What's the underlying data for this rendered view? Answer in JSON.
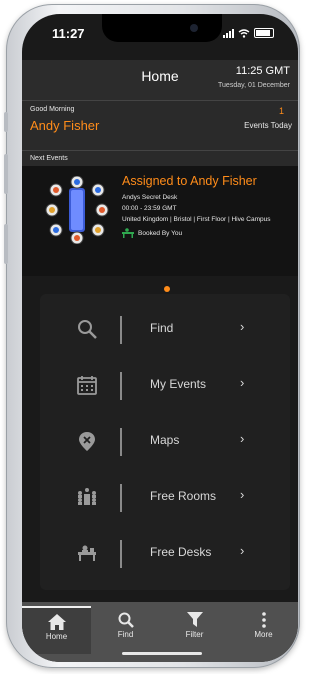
{
  "status_bar": {
    "time": "11:27"
  },
  "header": {
    "title": "Home",
    "time": "11:25 GMT",
    "date": "Tuesday, 01 December"
  },
  "greeting": {
    "text": "Good Morning",
    "user_name": "Andy Fisher",
    "events_count": "1",
    "events_label": "Events Today"
  },
  "next_events_label": "Next Events",
  "event": {
    "title": "Assigned to Andy Fisher",
    "resource": "Andys Secret Desk",
    "time_range": "00:00 - 23:59 GMT",
    "location": "United Kingdom | Bristol | First Floor | Hive Campus",
    "status": "Booked By You"
  },
  "menu": {
    "items": [
      {
        "label": "Find",
        "icon": "search-icon"
      },
      {
        "label": "My Events",
        "icon": "calendar-icon"
      },
      {
        "label": "Maps",
        "icon": "map-pin-icon"
      },
      {
        "label": "Free Rooms",
        "icon": "meeting-room-icon"
      },
      {
        "label": "Free Desks",
        "icon": "desk-icon"
      }
    ],
    "chevron": "›"
  },
  "tabs": [
    {
      "label": "Home",
      "icon": "home-icon",
      "active": true
    },
    {
      "label": "Find",
      "icon": "search-icon",
      "active": false
    },
    {
      "label": "Filter",
      "icon": "filter-icon",
      "active": false
    },
    {
      "label": "More",
      "icon": "more-vertical-icon",
      "active": false
    }
  ],
  "colors": {
    "accent": "#ff8c1a",
    "background": "#1a1a1a",
    "panel": "#202020",
    "tab_bar": "#505050"
  }
}
